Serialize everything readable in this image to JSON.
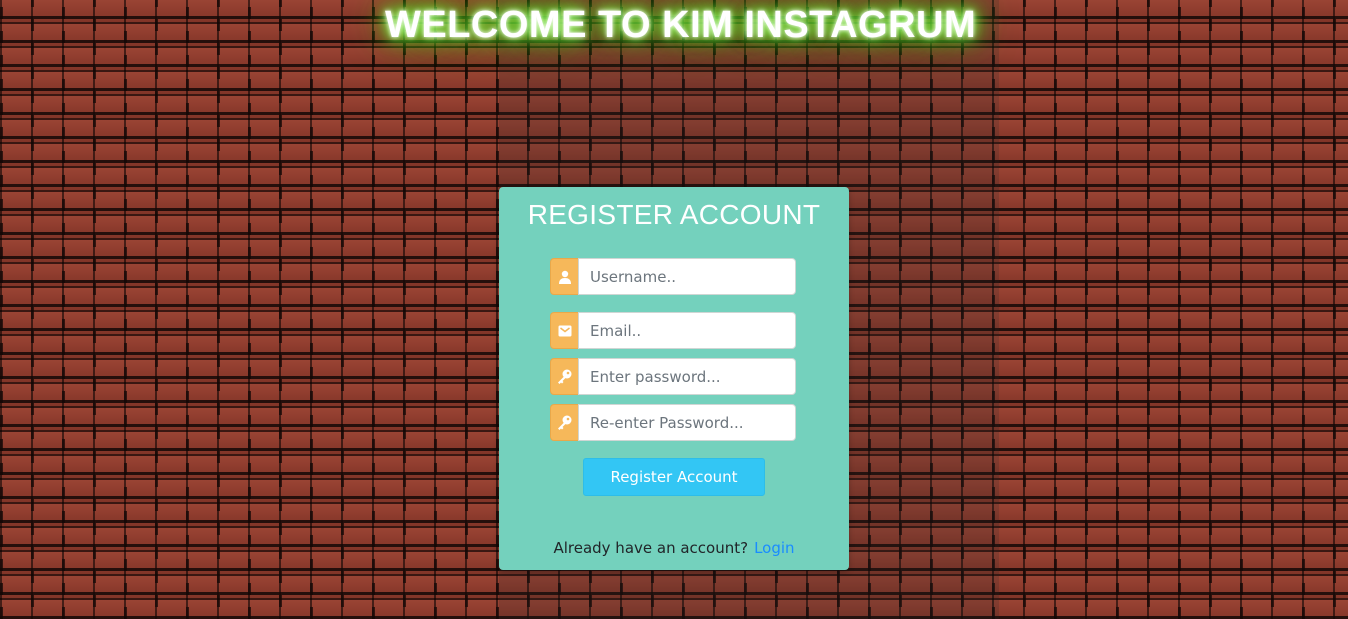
{
  "page": {
    "title": "WELCOME TO KIM INSTAGRUM"
  },
  "register_card": {
    "heading": "REGISTER ACCOUNT",
    "username": {
      "placeholder": "Username..",
      "value": "",
      "icon": "user-icon"
    },
    "email": {
      "placeholder": "Email..",
      "value": "",
      "icon": "envelope-icon"
    },
    "password": {
      "placeholder": "Enter password...",
      "value": "",
      "icon": "key-icon"
    },
    "confirm_password": {
      "placeholder": "Re-enter Password...",
      "value": "",
      "icon": "key-icon"
    },
    "submit_label": "Register Account",
    "login_prompt": "Already have an account?",
    "login_link": "Login"
  },
  "colors": {
    "card_bg": "#74d1bd",
    "addon_bg": "#f6b85a",
    "button_bg": "#33c6f4",
    "link": "#1a8cff",
    "neon_glow": "#66ff33",
    "wall": "#8a3a2c"
  }
}
